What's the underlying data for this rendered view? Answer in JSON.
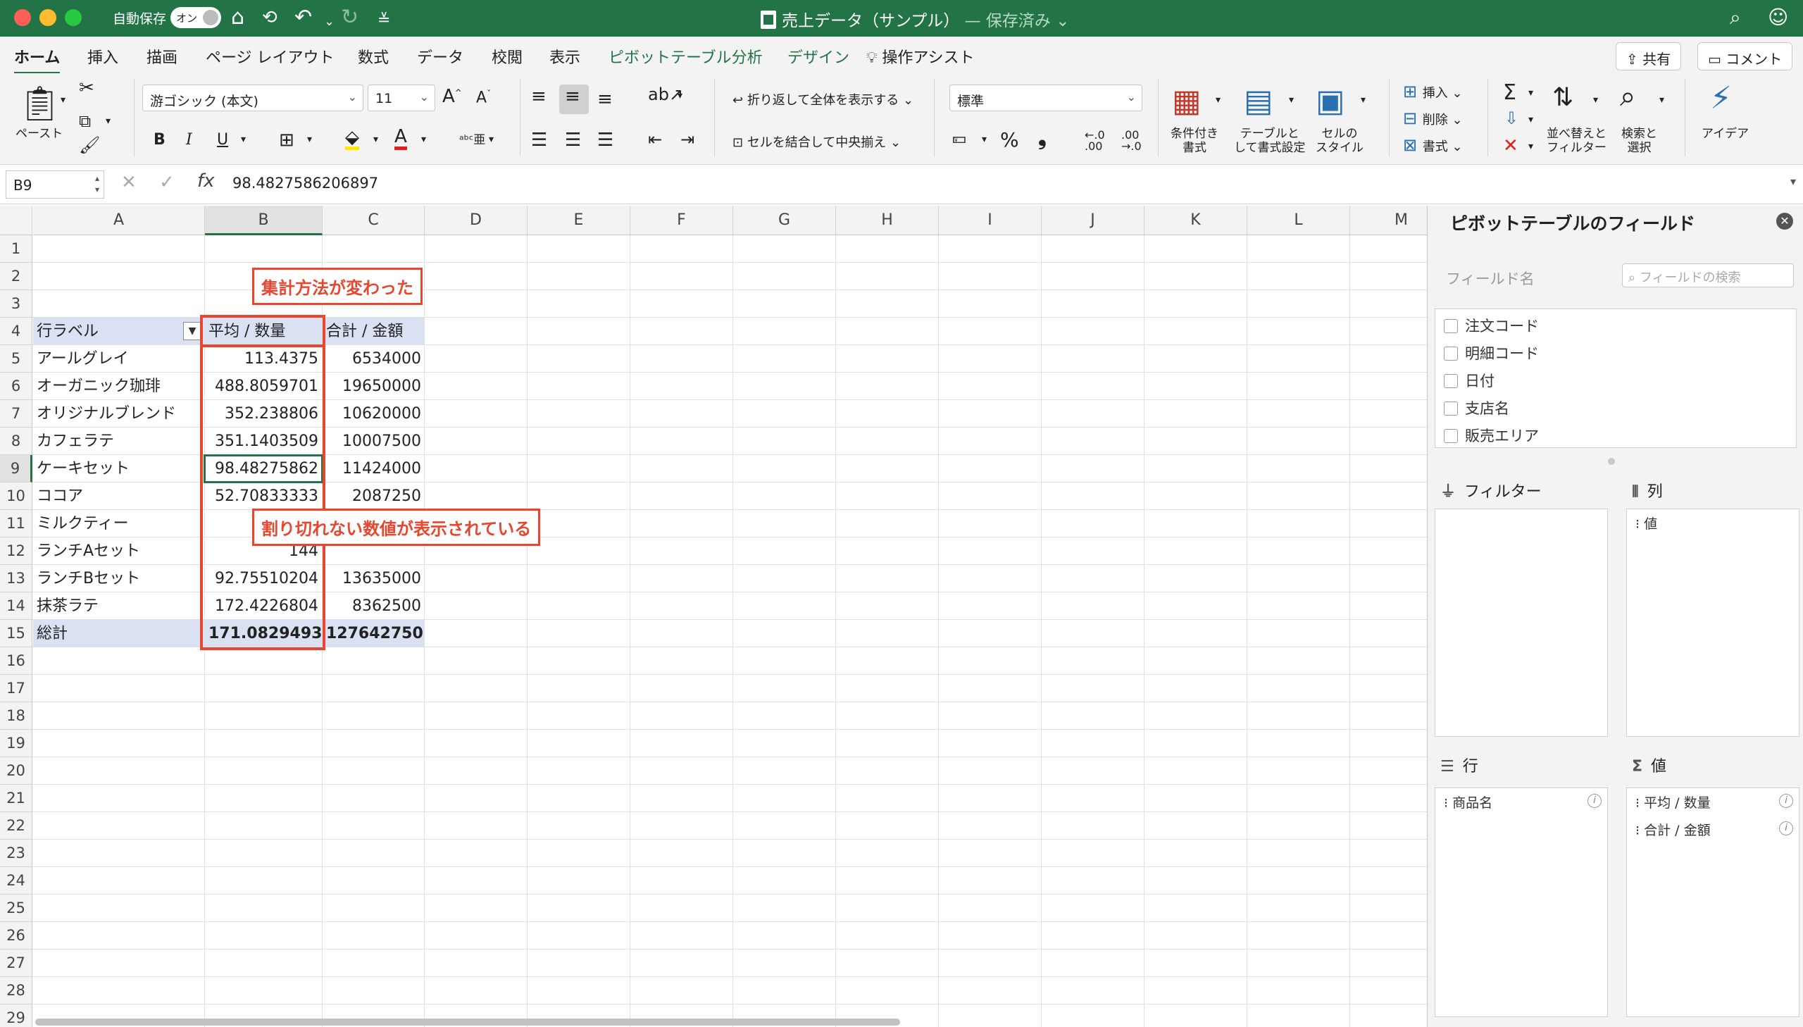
{
  "titlebar": {
    "autosave_label": "自動保存",
    "autosave_state": "オン",
    "doc_title": "売上データ（サンプル）",
    "doc_status": "— 保存済み ⌄"
  },
  "tabs": [
    "ホーム",
    "挿入",
    "描画",
    "ページ レイアウト",
    "数式",
    "データ",
    "校閲",
    "表示",
    "ピボットテーブル分析",
    "デザイン",
    "操作アシスト"
  ],
  "share": {
    "share_label": "共有",
    "comment_label": "コメント"
  },
  "ribbon": {
    "paste_label": "ペースト",
    "font_name": "游ゴシック (本文)",
    "font_size": "11",
    "wrap_text": "折り返して全体を表示する",
    "merge_center": "セルを結合して中央揃え",
    "number_format": "標準",
    "cond_format": "条件付き\n書式",
    "table_format": "テーブルと\nして書式設定",
    "cell_style": "セルの\nスタイル",
    "insert": "挿入",
    "delete": "削除",
    "format": "書式",
    "sort_filter": "並べ替えと\nフィルター",
    "find_select": "検索と\n選択",
    "ideas": "アイデア"
  },
  "formula_bar": {
    "name_box": "B9",
    "formula": "98.4827586206897"
  },
  "columns": [
    "A",
    "B",
    "C",
    "D",
    "E",
    "F",
    "G",
    "H",
    "I",
    "J",
    "K",
    "L",
    "M"
  ],
  "rows": [
    "1",
    "2",
    "3",
    "4",
    "5",
    "6",
    "7",
    "8",
    "9",
    "10",
    "11",
    "12",
    "13",
    "14",
    "15",
    "16",
    "17",
    "18",
    "19",
    "20",
    "21",
    "22",
    "23",
    "24",
    "25",
    "26",
    "27",
    "28",
    "29"
  ],
  "pivot_table": {
    "row_label_header": "行ラベル",
    "avg_header": "平均 / 数量",
    "sum_header": "合計 / 金額",
    "rows": [
      {
        "label": "アールグレイ",
        "avg": "113.4375",
        "sum": "6534000"
      },
      {
        "label": "オーガニック珈琲",
        "avg": "488.8059701",
        "sum": "19650000"
      },
      {
        "label": "オリジナルブレンド",
        "avg": "352.238806",
        "sum": "10620000"
      },
      {
        "label": "カフェラテ",
        "avg": "351.1403509",
        "sum": "10007500"
      },
      {
        "label": "ケーキセット",
        "avg": "98.48275862",
        "sum": "11424000"
      },
      {
        "label": "ココア",
        "avg": "52.70833333",
        "sum": "2087250"
      },
      {
        "label": "ミルクティー",
        "avg": "",
        "sum": ""
      },
      {
        "label": "ランチAセット",
        "avg": "144",
        "sum": ""
      },
      {
        "label": "ランチBセット",
        "avg": "92.75510204",
        "sum": "13635000"
      },
      {
        "label": "抹茶ラテ",
        "avg": "172.4226804",
        "sum": "8362500"
      }
    ],
    "total": {
      "label": "総計",
      "avg": "171.0829493",
      "sum": "127642750"
    }
  },
  "annotations": {
    "top": "集計方法が変わった",
    "middle": "割り切れない数値が表示されている"
  },
  "pivot_panel": {
    "title": "ピボットテーブルのフィールド",
    "field_name_label": "フィールド名",
    "search_placeholder": "フィールドの検索",
    "fields": [
      "注文コード",
      "明細コード",
      "日付",
      "支店名",
      "販売エリア"
    ],
    "filter_label": "フィルター",
    "columns_label": "列",
    "rows_label": "行",
    "values_label": "値",
    "column_items": [
      "値"
    ],
    "row_items": [
      "商品名"
    ],
    "value_items": [
      "平均 / 数量",
      "合計 / 金額"
    ]
  },
  "colors": {
    "accent": "#227447",
    "annotation": "#e8462f",
    "pivot_header": "#d9e1f2"
  }
}
